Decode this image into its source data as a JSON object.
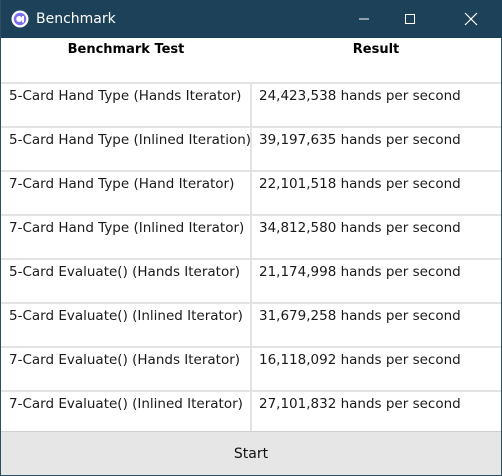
{
  "window": {
    "title": "Benchmark",
    "icon": "app-logo-icon",
    "controls": [
      "minimize-icon",
      "maximize-icon",
      "close-icon"
    ]
  },
  "table": {
    "headers": [
      "Benchmark Test",
      "Result"
    ],
    "rows": [
      {
        "test": "5-Card Hand Type (Hands Iterator)",
        "result": "24,423,538 hands per second"
      },
      {
        "test": "5-Card Hand Type (Inlined Iteration)",
        "result": "39,197,635 hands per second"
      },
      {
        "test": "7-Card Hand Type (Hand Iterator)",
        "result": "22,101,518 hands per second"
      },
      {
        "test": "7-Card Hand Type (Inlined Iterator)",
        "result": "34,812,580 hands per second"
      },
      {
        "test": "5-Card Evaluate() (Hands Iterator)",
        "result": "21,174,998 hands per second"
      },
      {
        "test": "5-Card Evaluate() (Inlined Iterator)",
        "result": "31,679,258 hands per second"
      },
      {
        "test": "7-Card Evaluate() (Hands Iterator)",
        "result": "16,118,092 hands per second"
      },
      {
        "test": "7-Card Evaluate() (Inlined Iterator)",
        "result": "27,101,832 hands per second"
      }
    ]
  },
  "footer": {
    "start_label": "Start"
  },
  "colors": {
    "titlebar": "#1c4159",
    "icon_accent": "#7b6ff0",
    "grid_line": "#e3e3e3",
    "button_bg": "#e6e6e6"
  }
}
